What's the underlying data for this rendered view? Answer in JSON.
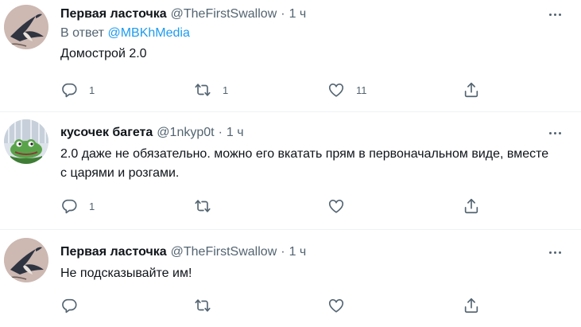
{
  "tweets": [
    {
      "name": "Первая ласточка",
      "handle": "@TheFirstSwallow",
      "dot": "·",
      "time": "1 ч",
      "reply_prefix": "В ответ",
      "reply_to": "@MBKhMedia",
      "text": "Домострой 2.0",
      "reply_count": "1",
      "retweet_count": "1",
      "like_count": "11",
      "avatar": "swallow-avatar"
    },
    {
      "name": "кусочек багета",
      "handle": "@1nkyp0t",
      "dot": "·",
      "time": "1 ч",
      "text": "2.0 даже не обязательно. можно его вкатать прям в первоначальном виде, вместе с царями и розгами.",
      "reply_count": "1",
      "retweet_count": "",
      "like_count": "",
      "avatar": "frog-avatar"
    },
    {
      "name": "Первая ласточка",
      "handle": "@TheFirstSwallow",
      "dot": "·",
      "time": "1 ч",
      "text": "Не подсказывайте им!",
      "reply_count": "",
      "retweet_count": "",
      "like_count": "",
      "avatar": "swallow-avatar"
    }
  ],
  "icons": {
    "reply": "reply-icon",
    "retweet": "retweet-icon",
    "like": "heart-icon",
    "share": "share-icon",
    "more": "more-icon"
  },
  "colors": {
    "link": "#1d9bf0",
    "secondary": "#536471",
    "text": "#0f1419"
  }
}
